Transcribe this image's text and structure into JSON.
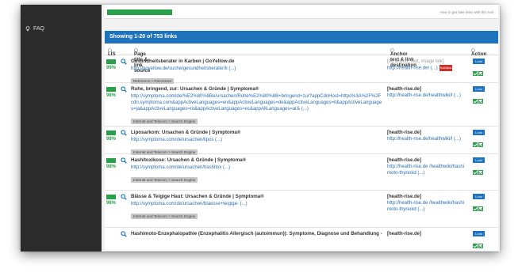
{
  "sidebar": {
    "faq_label": "FAQ"
  },
  "topbar": {
    "hint": "How to get fake links with this tool"
  },
  "panel": {
    "heading": "Showing 1-20 of 753 links",
    "columns": {
      "lis": "LIS",
      "source": "Page title & link source",
      "anchor": "Anchor text & link destination",
      "action": "Action"
    }
  },
  "actions": {
    "look_label": "Look"
  },
  "rows": [
    {
      "pct": "99%",
      "title": "Gesundheitsberater in Karben | GoYellow.de",
      "url": "http://goyellow.de/suche/gesundheitsberater/k (...)",
      "category": "Reference > Directories",
      "anchor": "[no anchor text, image link]",
      "anchor_grey": true,
      "dest": "http://health-rise.de/ (...)",
      "nofollow": "Nofollow"
    },
    {
      "pct": "98%",
      "title": "Ruhe, bringend, zur: Ursachen & Gründe | Symptoma®",
      "url": "http://symptoma.com/de/%E2%80%8Be/ursachen/Ruhe%E2%80%8B+bringend+zur?appCdnHost=https%3A%2F%2Fcdn.symptoma.com&appActiveLanguages=en&appActiveLanguages=de&appActiveLanguages=it&appActiveLanguages=ja&appActiveLanguages=ro&appActiveLanguages=es&appAllLanguages=ar& (...)",
      "category": "Internet and Telecom > Search Engine",
      "anchor": "[health-rise.de]",
      "anchor_grey": false,
      "dest": "http://health-rise.de/healthwiki/l (...)",
      "nofollow": ""
    },
    {
      "pct": "98%",
      "title": "Liposarkom: Ursachen & Gründe | Symptoma®",
      "url": "http://symptoma.com/de/ursachen/lipos (...)",
      "category": "Internet and Telecom > Search Engine",
      "anchor": "[health-rise.de]",
      "anchor_grey": false,
      "dest": "http://health-rise.de/healthwiki/l (...)",
      "nofollow": ""
    },
    {
      "pct": "98%",
      "title": "Hashitoxikose: Ursachen & Gründe | Symptoma®",
      "url": "http://symptoma.com/de/ursachen/hashitox (...)",
      "category": "Internet and Telecom > Search Engine",
      "anchor": "[health-rise.de]",
      "anchor_grey": false,
      "dest": "http://health-rise.de /healthwiki/hashimoto-thyreoid (...)",
      "nofollow": ""
    },
    {
      "pct": "98%",
      "title": "Blässe & Teigige Haut: Ursachen & Gründe | Symptoma®",
      "url": "http://symptoma.com/de/ursachen/blaesse+teigige- (...)",
      "category": "Internet and Telecom > Search Engine",
      "anchor": "[health-rise.de]",
      "anchor_grey": false,
      "dest": "http://health-rise.de /healthwiki/hashimoto-thyreoid (...)",
      "nofollow": ""
    },
    {
      "pct": "",
      "title": "Hashimoto-Enzephalopathie (Enzephalitis Allergisch (autoimmun)): Symptome, Diagnose und Behandlung -",
      "url": "",
      "category": "",
      "anchor": "[health-rise.de]",
      "anchor_grey": false,
      "dest": "",
      "nofollow": ""
    }
  ]
}
